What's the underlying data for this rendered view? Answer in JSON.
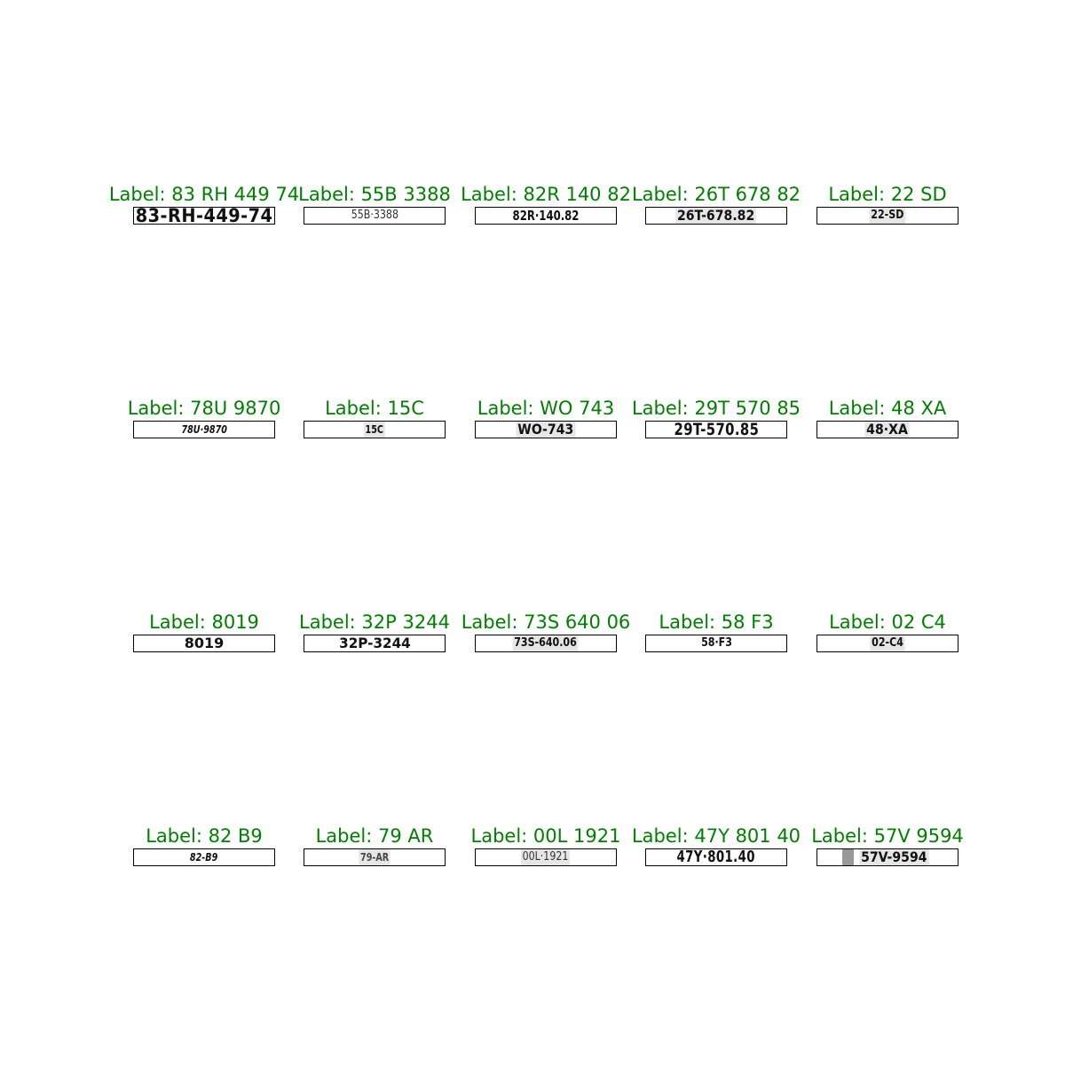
{
  "grid": [
    [
      {
        "label": "Label: 83 RH 449 74",
        "plate": "83-RH-449-74"
      },
      {
        "label": "Label: 55B 3388",
        "plate": "55B·3388"
      },
      {
        "label": "Label: 82R 140 82",
        "plate": "82R·140.82"
      },
      {
        "label": "Label: 26T 678 82",
        "plate": "26T-678.82"
      },
      {
        "label": "Label: 22 SD",
        "plate": "22-SD"
      }
    ],
    [
      {
        "label": "Label: 78U 9870",
        "plate": "78U·9870"
      },
      {
        "label": "Label: 15C",
        "plate": "15C"
      },
      {
        "label": "Label: WO 743",
        "plate": "WO-743"
      },
      {
        "label": "Label: 29T 570 85",
        "plate": "29T-570.85"
      },
      {
        "label": "Label: 48 XA",
        "plate": "48·XA"
      }
    ],
    [
      {
        "label": "Label: 8019",
        "plate": "8019"
      },
      {
        "label": "Label: 32P 3244",
        "plate": "32P-3244"
      },
      {
        "label": "Label: 73S 640 06",
        "plate": "73S-640.06"
      },
      {
        "label": "Label: 58 F3",
        "plate": "58·F3"
      },
      {
        "label": "Label: 02 C4",
        "plate": "02-C4"
      }
    ],
    [
      {
        "label": "Label: 82 B9",
        "plate": "82-B9"
      },
      {
        "label": "Label: 79 AR",
        "plate": "79-AR"
      },
      {
        "label": "Label: 00L 1921",
        "plate": "00L·1921"
      },
      {
        "label": "Label: 47Y 801 40",
        "plate": "47Y·801.40"
      },
      {
        "label": "Label: 57V 9594",
        "plate": "57V-9594"
      }
    ]
  ],
  "colors": {
    "label": "#008000",
    "plate_border": "#000000",
    "plate_text": "#111111"
  }
}
